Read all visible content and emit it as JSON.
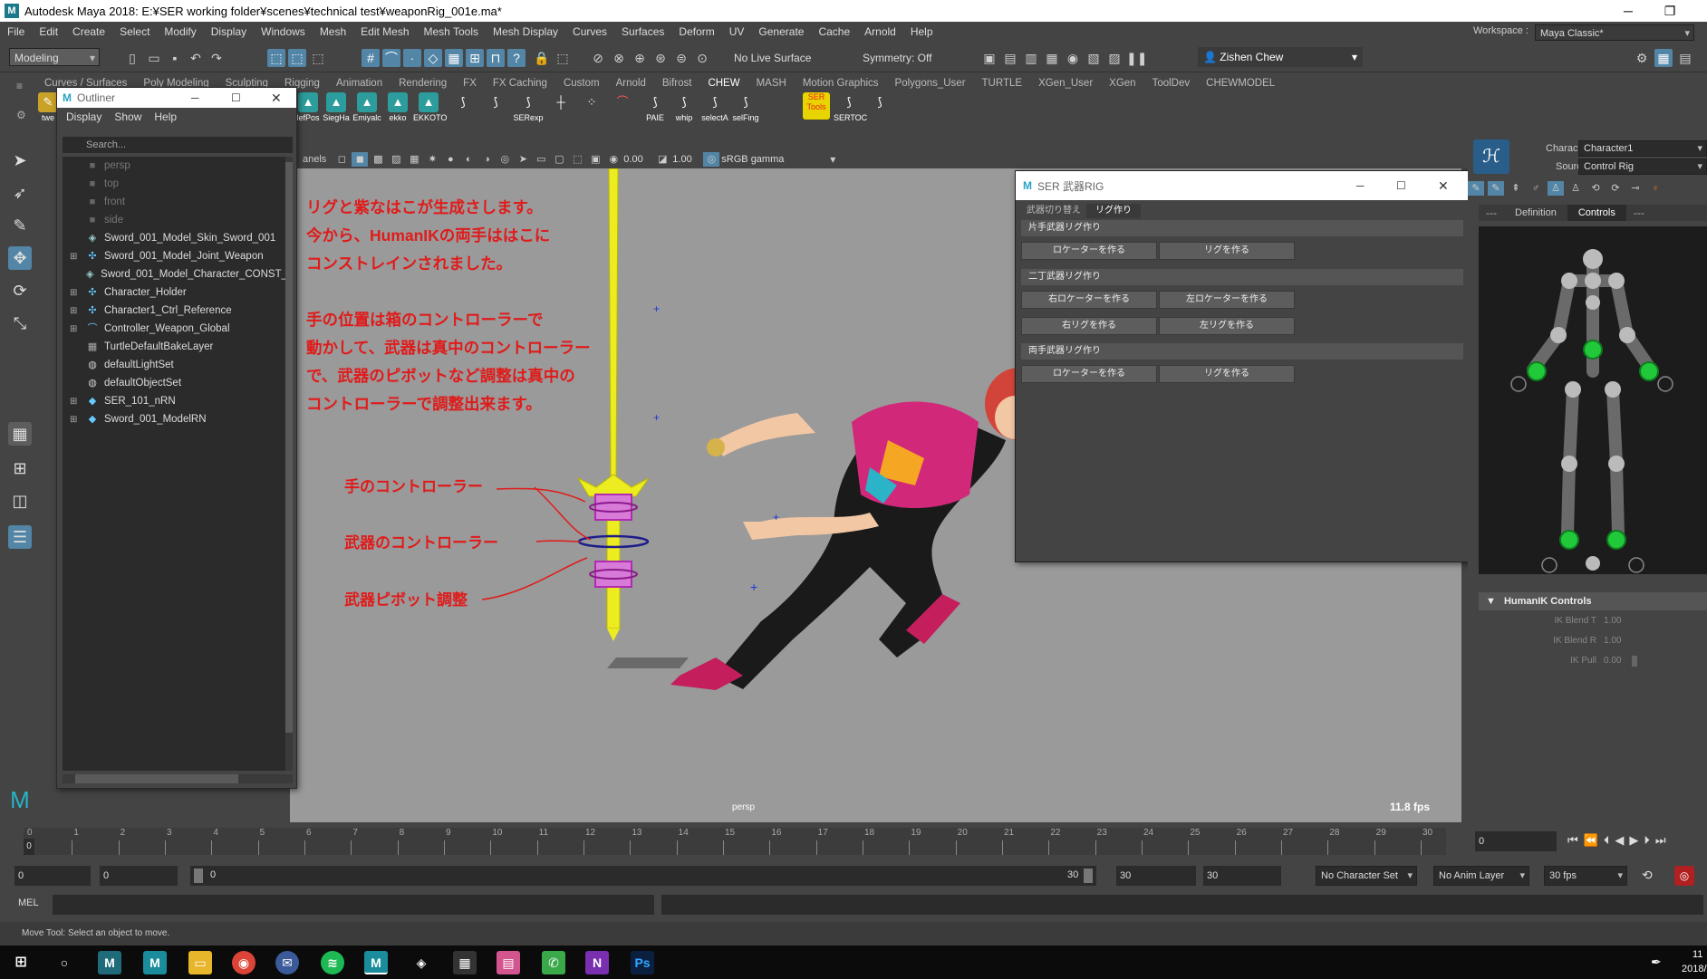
{
  "window": {
    "title": "Autodesk Maya 2018: E:¥SER working folder¥scenes¥technical test¥weaponRig_001e.ma*",
    "logo": "M"
  },
  "menus": [
    "File",
    "Edit",
    "Create",
    "Select",
    "Modify",
    "Display",
    "Windows",
    "Mesh",
    "Edit Mesh",
    "Mesh Tools",
    "Mesh Display",
    "Curves",
    "Surfaces",
    "Deform",
    "UV",
    "Generate",
    "Cache",
    "Arnold",
    "Help"
  ],
  "workspace": {
    "label": "Workspace :",
    "value": "Maya Classic*"
  },
  "status": {
    "mode": "Modeling",
    "live_surface": "No Live Surface",
    "symmetry": "Symmetry: Off",
    "user": "Zishen Chew"
  },
  "shelf_tabs": [
    "Curves / Surfaces",
    "Poly Modeling",
    "Sculpting",
    "Rigging",
    "Animation",
    "Rendering",
    "FX",
    "FX Caching",
    "Custom",
    "Arnold",
    "Bifrost",
    "CHEW",
    "MASH",
    "Motion Graphics",
    "Polygons_User",
    "TURTLE",
    "XGen_User",
    "XGen",
    "ToolDev",
    "CHEWMODEL"
  ],
  "shelf_active": "CHEW",
  "shelf_items": [
    "twe",
    "lefPos",
    "SiegHa",
    "Emiyalc",
    "ekko",
    "EKKOTO",
    "",
    "",
    "SERexp",
    "",
    "",
    "",
    "PAIE",
    "whip",
    "selectA",
    "selFing",
    "SER Tools",
    "SERTOC",
    ""
  ],
  "outliner": {
    "title": "Outliner",
    "menu": [
      "Display",
      "Show",
      "Help"
    ],
    "search_placeholder": "Search...",
    "items": [
      {
        "name": "persp",
        "icon": "camera-icon",
        "dim": true,
        "expand": false
      },
      {
        "name": "top",
        "icon": "camera-icon",
        "dim": true,
        "expand": false
      },
      {
        "name": "front",
        "icon": "camera-icon",
        "dim": true,
        "expand": false
      },
      {
        "name": "side",
        "icon": "camera-icon",
        "dim": true,
        "expand": false
      },
      {
        "name": "Sword_001_Model_Skin_Sword_001",
        "icon": "mesh-icon",
        "dim": false,
        "expand": false
      },
      {
        "name": "Sword_001_Model_Joint_Weapon",
        "icon": "joint-icon",
        "dim": false,
        "expand": true
      },
      {
        "name": "Sword_001_Model_Character_CONST_",
        "icon": "mesh-icon",
        "dim": false,
        "expand": false
      },
      {
        "name": "Character_Holder",
        "icon": "joint-icon",
        "dim": false,
        "expand": true
      },
      {
        "name": "Character1_Ctrl_Reference",
        "icon": "joint-icon",
        "dim": false,
        "expand": true
      },
      {
        "name": "Controller_Weapon_Global",
        "icon": "curve-icon",
        "dim": false,
        "expand": true
      },
      {
        "name": "TurtleDefaultBakeLayer",
        "icon": "node-icon",
        "dim": false,
        "expand": false
      },
      {
        "name": "defaultLightSet",
        "icon": "set-icon",
        "dim": false,
        "expand": false
      },
      {
        "name": "defaultObjectSet",
        "icon": "set-icon",
        "dim": false,
        "expand": false
      },
      {
        "name": "SER_101_nRN",
        "icon": "reference-icon",
        "dim": false,
        "expand": true
      },
      {
        "name": "Sword_001_ModelRN",
        "icon": "reference-icon",
        "dim": false,
        "expand": true
      }
    ]
  },
  "viewport": {
    "panels_label": "anels",
    "exposure": "0.00",
    "gamma": "1.00",
    "color_space": "sRGB gamma",
    "camera": "persp",
    "fps": "11.8 fps",
    "annotations": [
      "リグと紫なはこが生成さします。",
      "今から、HumanIKの両手ははこに",
      "コンストレインされました。",
      "",
      "手の位置は箱のコントローラーで",
      "動かして、武器は真中のコントローラー",
      "で、武器のピボットなど調整は真中の",
      "コントローラーで調整出来ます。"
    ],
    "labels": {
      "hand": "手のコントローラー",
      "weapon": "武器のコントローラー",
      "pivot": "武器ピボット調整"
    }
  },
  "rig_window": {
    "title": "SER 武器RIG",
    "tabs": [
      "武器切り替え",
      "リグ作り"
    ],
    "active_tab": "リグ作り",
    "sections": [
      {
        "title": "片手武器リグ作り",
        "buttons": [
          [
            "ロケーターを作る",
            "リグを作る"
          ]
        ]
      },
      {
        "title": "二丁武器リグ作り",
        "buttons": [
          [
            "右ロケーターを作る",
            "左ロケーターを作る"
          ],
          [
            "右リグを作る",
            "左リグを作る"
          ]
        ]
      },
      {
        "title": "両手武器リグ作り",
        "buttons": [
          [
            "ロケーターを作る",
            "リグを作る"
          ]
        ]
      }
    ]
  },
  "humanik": {
    "character_label": "Character:",
    "character": "Character1",
    "source_label": "Source:",
    "source": "Control Rig",
    "tabs": [
      "Definition",
      "Controls"
    ],
    "active_tab": "Controls",
    "section": "HumanIK Controls",
    "fields": [
      {
        "label": "IK Blend T",
        "value": "1.00"
      },
      {
        "label": "IK Blend R",
        "value": "1.00"
      },
      {
        "label": "IK Pull",
        "value": "0.00"
      }
    ]
  },
  "timeline": {
    "ticks": [
      "0",
      "1",
      "2",
      "3",
      "4",
      "5",
      "6",
      "7",
      "8",
      "9",
      "10",
      "11",
      "12",
      "13",
      "14",
      "15",
      "16",
      "17",
      "18",
      "19",
      "20",
      "21",
      "22",
      "23",
      "24",
      "25",
      "26",
      "27",
      "28",
      "29",
      "30"
    ],
    "current_frame": "0",
    "frame_field": "0"
  },
  "range": {
    "start": "0",
    "anim_start": "0",
    "slider_start": "0",
    "slider_end": "30",
    "anim_end": "30",
    "end": "30",
    "character_set": "No Character Set",
    "anim_layer": "No Anim Layer",
    "fps": "30 fps"
  },
  "command": {
    "lang": "MEL"
  },
  "help_line": "Move Tool: Select an object to move.",
  "taskbar": {
    "time": "11",
    "date": "2018/"
  }
}
